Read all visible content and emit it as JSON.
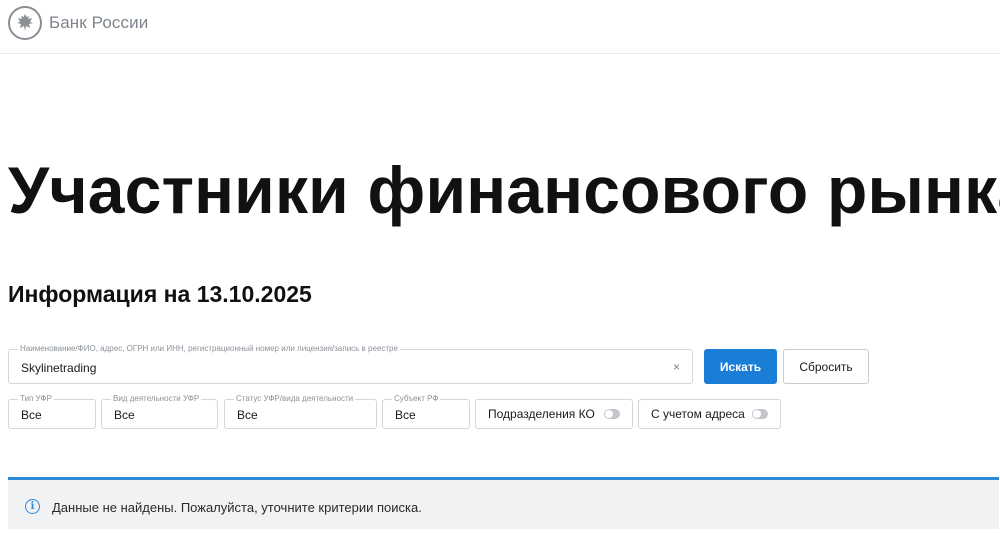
{
  "header": {
    "logo_text": "Банк России"
  },
  "page": {
    "title": "Участники финансового рынка",
    "subtitle": "Информация на 13.10.2025"
  },
  "search": {
    "label": "Наименование/ФИО, адрес, ОГРН или ИНН, регистрационный номер или лицензия/запись в реестре",
    "value": "Skylinetrading",
    "clear_symbol": "×",
    "search_button": "Искать",
    "reset_button": "Сбросить"
  },
  "filters": [
    {
      "label": "Тип УФР",
      "value": "Все"
    },
    {
      "label": "Вид деятельности УФР",
      "value": "Все"
    },
    {
      "label": "Статус УФР/вида деятельности",
      "value": "Все"
    },
    {
      "label": "Субъект РФ",
      "value": "Все"
    }
  ],
  "toggles": [
    {
      "label": "Подразделения КО",
      "on": false
    },
    {
      "label": "С учетом адреса",
      "on": false
    }
  ],
  "notice": {
    "icon": "info-icon",
    "text": "Данные не найдены. Пожалуйста, уточните критерии поиска."
  },
  "colors": {
    "accent": "#1a7dd6",
    "notice_border": "#2f8bd8",
    "notice_bg": "#f1f2f4"
  }
}
